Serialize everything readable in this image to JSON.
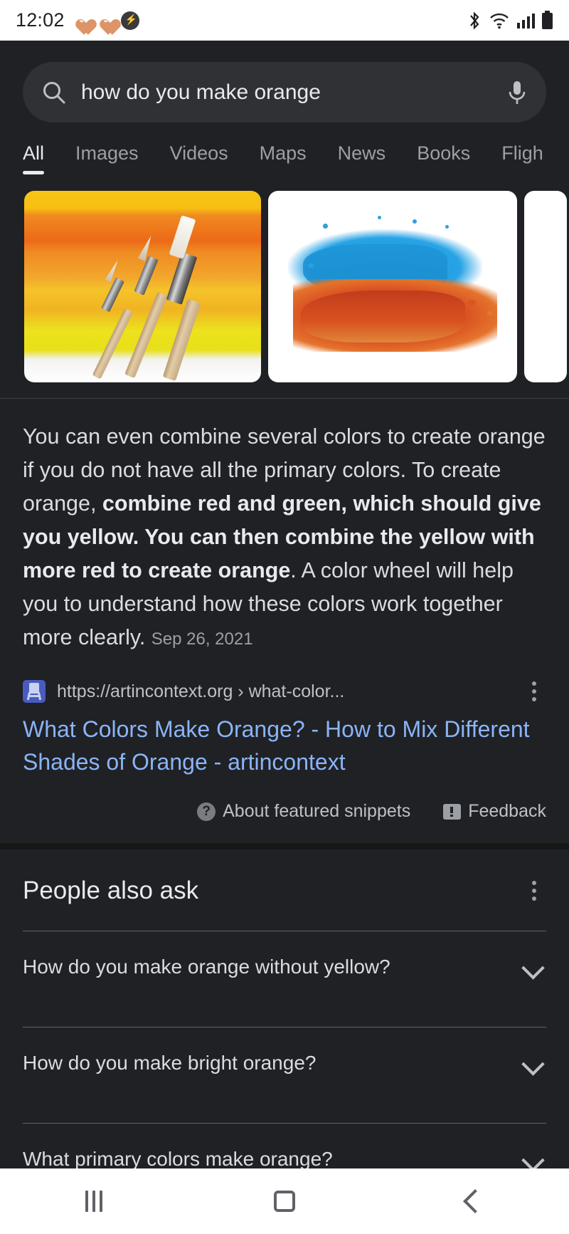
{
  "status_bar": {
    "time": "12:02",
    "left_icons": [
      "heart-notification-icon",
      "heart-notification-icon",
      "messenger-icon"
    ],
    "right_icons": [
      "bluetooth-icon",
      "wifi-icon",
      "cellular-signal-icon",
      "battery-icon"
    ]
  },
  "search": {
    "query": "how do you make orange",
    "placeholder": "Search",
    "search_icon": "search-icon",
    "mic_icon": "microphone-icon"
  },
  "tabs": [
    {
      "label": "All",
      "active": true
    },
    {
      "label": "Images",
      "active": false
    },
    {
      "label": "Videos",
      "active": false
    },
    {
      "label": "Maps",
      "active": false
    },
    {
      "label": "News",
      "active": false
    },
    {
      "label": "Books",
      "active": false
    },
    {
      "label": "Fligh",
      "active": false
    }
  ],
  "image_strip": [
    {
      "alt": "watercolor-orange-gradient-with-paintbrushes"
    },
    {
      "alt": "blue-and-orange-paint-strokes"
    },
    {
      "alt": "third-image-partial"
    }
  ],
  "snippet": {
    "text_part_1": "You can even combine several colors to create orange if you do not have all the primary colors. To create orange, ",
    "text_bold": "combine red and green, which should give you yellow. You can then combine the yellow with more red to create orange",
    "text_part_2": ". A color wheel will help you to understand how these colors work together more clearly. ",
    "date": "Sep 26, 2021",
    "source_url": "https://artincontext.org › what-color...",
    "favicon": "artincontext-easel-favicon",
    "kebab_icon": "more-options-icon",
    "result_title": "What Colors Make Orange? - How to Mix Different Shades of Orange - artincontext",
    "about_snippets_label": "About featured snippets",
    "about_snippets_icon": "question-mark-icon",
    "feedback_label": "Feedback",
    "feedback_icon": "feedback-icon"
  },
  "people_also_ask": {
    "title": "People also ask",
    "kebab_icon": "more-options-icon",
    "questions": [
      {
        "text": "How do you make orange without yellow?",
        "chevron": "chevron-down-icon"
      },
      {
        "text": "How do you make bright orange?",
        "chevron": "chevron-down-icon"
      },
      {
        "text": "What primary colors make orange?",
        "chevron": "chevron-down-icon"
      }
    ]
  },
  "nav_bar": {
    "recents_label": "recents-button",
    "home_label": "home-button",
    "back_label": "back-button"
  },
  "colors": {
    "background": "#202124",
    "search_field": "#303134",
    "link_blue": "#8ab4f8",
    "text_primary": "#e8eaed",
    "text_secondary": "#bdc1c6",
    "text_muted": "#9aa0a6"
  }
}
